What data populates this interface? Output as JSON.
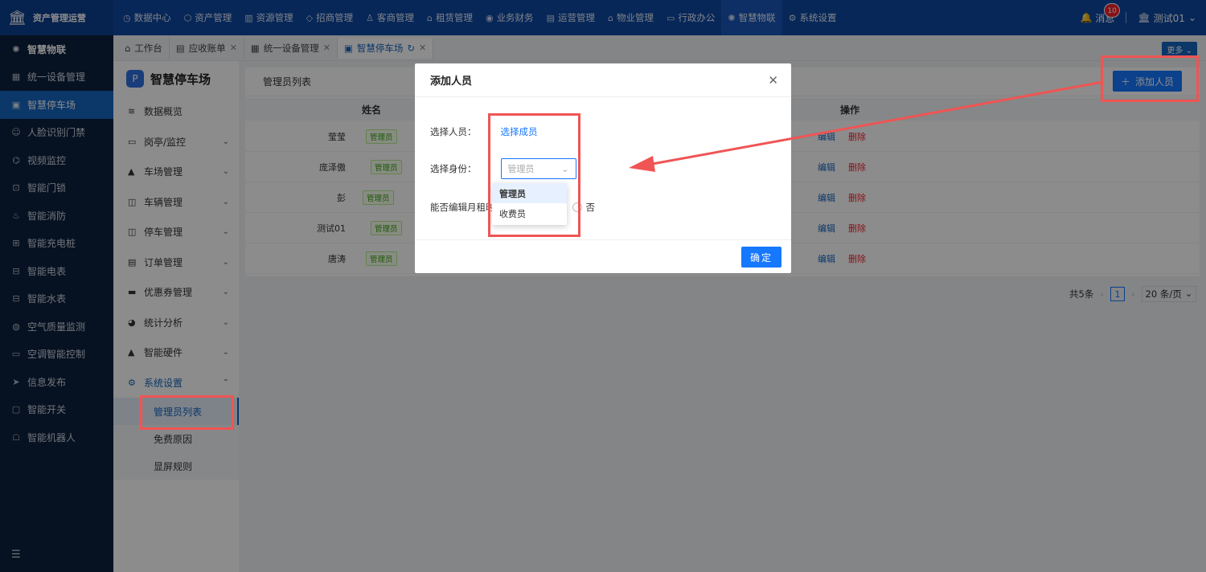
{
  "brand": {
    "name": "资产管理运营",
    "logo_icon": "building-icon"
  },
  "topnav": [
    {
      "label": "数据中心",
      "icon": "clock-icon"
    },
    {
      "label": "资产管理",
      "icon": "cube-icon"
    },
    {
      "label": "资源管理",
      "icon": "building-icon"
    },
    {
      "label": "招商管理",
      "icon": "tag-icon"
    },
    {
      "label": "客商管理",
      "icon": "user-icon"
    },
    {
      "label": "租赁管理",
      "icon": "house-icon"
    },
    {
      "label": "业务财务",
      "icon": "coin-icon"
    },
    {
      "label": "运营管理",
      "icon": "chart-icon"
    },
    {
      "label": "物业管理",
      "icon": "home-icon"
    },
    {
      "label": "行政办公",
      "icon": "monitor-icon"
    },
    {
      "label": "智慧物联",
      "icon": "sun-icon",
      "active": true
    },
    {
      "label": "系统设置",
      "icon": "gear-icon"
    }
  ],
  "header_right": {
    "messages_label": "消息",
    "messages_count": "10",
    "user": "测试01"
  },
  "sidebar": {
    "head": "智慧物联",
    "items": [
      "统一设备管理",
      "智慧停车场",
      "人脸识别门禁",
      "视频监控",
      "智能门锁",
      "智能消防",
      "智能充电桩",
      "智能电表",
      "智能水表",
      "空气质量监测",
      "空调智能控制",
      "信息发布",
      "智能开关",
      "智能机器人"
    ],
    "active_index": 1
  },
  "tabs": [
    {
      "label": "工作台"
    },
    {
      "label": "应收账单"
    },
    {
      "label": "统一设备管理"
    },
    {
      "label": "智慧停车场",
      "active": true
    }
  ],
  "more_label": "更多",
  "subpanel": {
    "title": "智慧停车场",
    "menus": [
      {
        "label": "数据概览"
      },
      {
        "label": "岗亭/监控"
      },
      {
        "label": "车场管理"
      },
      {
        "label": "车辆管理"
      },
      {
        "label": "停车管理"
      },
      {
        "label": "订单管理"
      },
      {
        "label": "优惠券管理"
      },
      {
        "label": "统计分析"
      },
      {
        "label": "智能硬件"
      },
      {
        "label": "系统设置"
      }
    ],
    "leaves": [
      "管理员列表",
      "免费原因",
      "显屏规则"
    ]
  },
  "main": {
    "card_title": "管理员列表",
    "add_button": "添加人员",
    "columns": {
      "name": "姓名",
      "ops": "操作"
    },
    "rows": [
      {
        "name": "莹莹",
        "tag": "管理员"
      },
      {
        "name": "庞泽傲",
        "tag": "管理员"
      },
      {
        "name": "彭",
        "tag": "管理员"
      },
      {
        "name": "测试01",
        "tag": "管理员"
      },
      {
        "name": "唐涛",
        "tag": "管理员"
      }
    ],
    "edit_label": "编辑",
    "delete_label": "删除",
    "pager": {
      "total": "共5条",
      "page": "1",
      "size": "20 条/页"
    }
  },
  "modal": {
    "title": "添加人员",
    "person_label": "选择人员：",
    "person_link": "选择成员",
    "role_label": "选择身份：",
    "role_placeholder": "管理员",
    "edit_label": "能否编辑月租时",
    "no_label": "否",
    "ok_label": "确定",
    "options": [
      "管理员",
      "收费员"
    ]
  },
  "colors": {
    "primary": "#1677ff",
    "topbar": "#0d47a1",
    "sidebar": "#0b1f3d",
    "highlight": "#f05454"
  }
}
